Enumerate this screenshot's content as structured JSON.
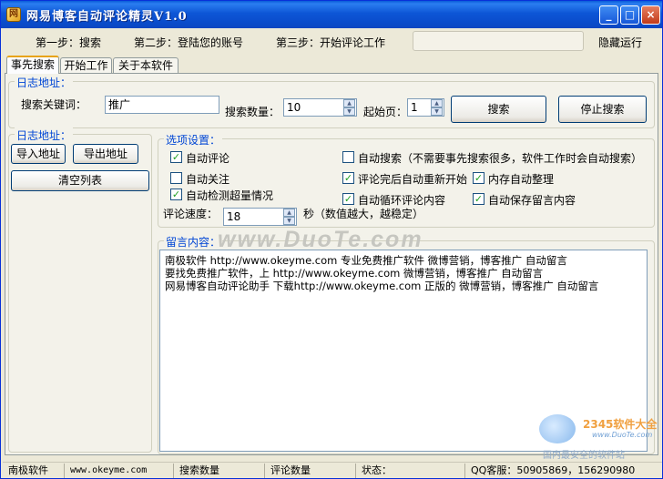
{
  "window": {
    "title": "网易博客自动评论精灵V1.0"
  },
  "title_buttons": {
    "minimize": "_",
    "maximize": "□",
    "close": "×"
  },
  "steps": {
    "step1": "第一步：搜索",
    "step2": "第二步：登陆您的账号",
    "step3": "第三步：开始评论工作",
    "hide": "隐藏运行"
  },
  "tabs": [
    "事先搜索",
    "开始工作",
    "关于本软件"
  ],
  "search_group": {
    "legend": "日志地址：",
    "keyword_label": "搜索关键词：",
    "keyword_value": "推广",
    "count_label": "搜索数量：",
    "count_value": "10",
    "start_page_label": "起始页：",
    "start_page_value": "1",
    "search_button": "搜索",
    "stop_button": "停止搜索"
  },
  "address_group": {
    "legend": "日志地址：",
    "import_button": "导入地址",
    "export_button": "导出地址",
    "clear_button": "清空列表"
  },
  "options_group": {
    "legend": "选项设置：",
    "auto_comment": {
      "label": "自动评论",
      "checked": true
    },
    "auto_search": {
      "label": "自动搜索（不需要事先搜索很多，软件工作时会自动搜索）",
      "checked": false
    },
    "auto_follow": {
      "label": "自动关注",
      "checked": false
    },
    "restart_after": {
      "label": "评论完后自动重新开始",
      "checked": true
    },
    "memory_cleanup": {
      "label": "内存自动整理",
      "checked": true
    },
    "auto_detect_overload": {
      "label": "自动检测超量情况",
      "checked": true
    },
    "auto_loop_content": {
      "label": "自动循环评论内容",
      "checked": true
    },
    "auto_save_content": {
      "label": "自动保存留言内容",
      "checked": true
    },
    "speed_label": "评论速度：",
    "speed_value": "18",
    "speed_unit": "秒（数值越大，越稳定）"
  },
  "message_group": {
    "legend": "留言内容：",
    "lines": [
      "南极软件 http://www.okeyme.com 专业免费推广软件  微博营销，博客推广 自动留言",
      "要找免费推广软件，上 http://www.okeyme.com  微博营销，博客推广 自动留言",
      "网易博客自动评论助手 下载http://www.okeyme.com 正版的 微博营销，博客推广 自动留言"
    ]
  },
  "watermarks": {
    "duote": "www.DuoTe.com",
    "site_name": "2345软件大全",
    "site_url": "www.DuoTe.com",
    "slogan": "国内最安全的软件站"
  },
  "statusbar": {
    "company": "南极软件",
    "website": "www.okeyme.com",
    "search_count": "搜索数量",
    "comment_count": "评论数量",
    "status": "状态：",
    "qq": "QQ客服：50905869，156290980"
  }
}
